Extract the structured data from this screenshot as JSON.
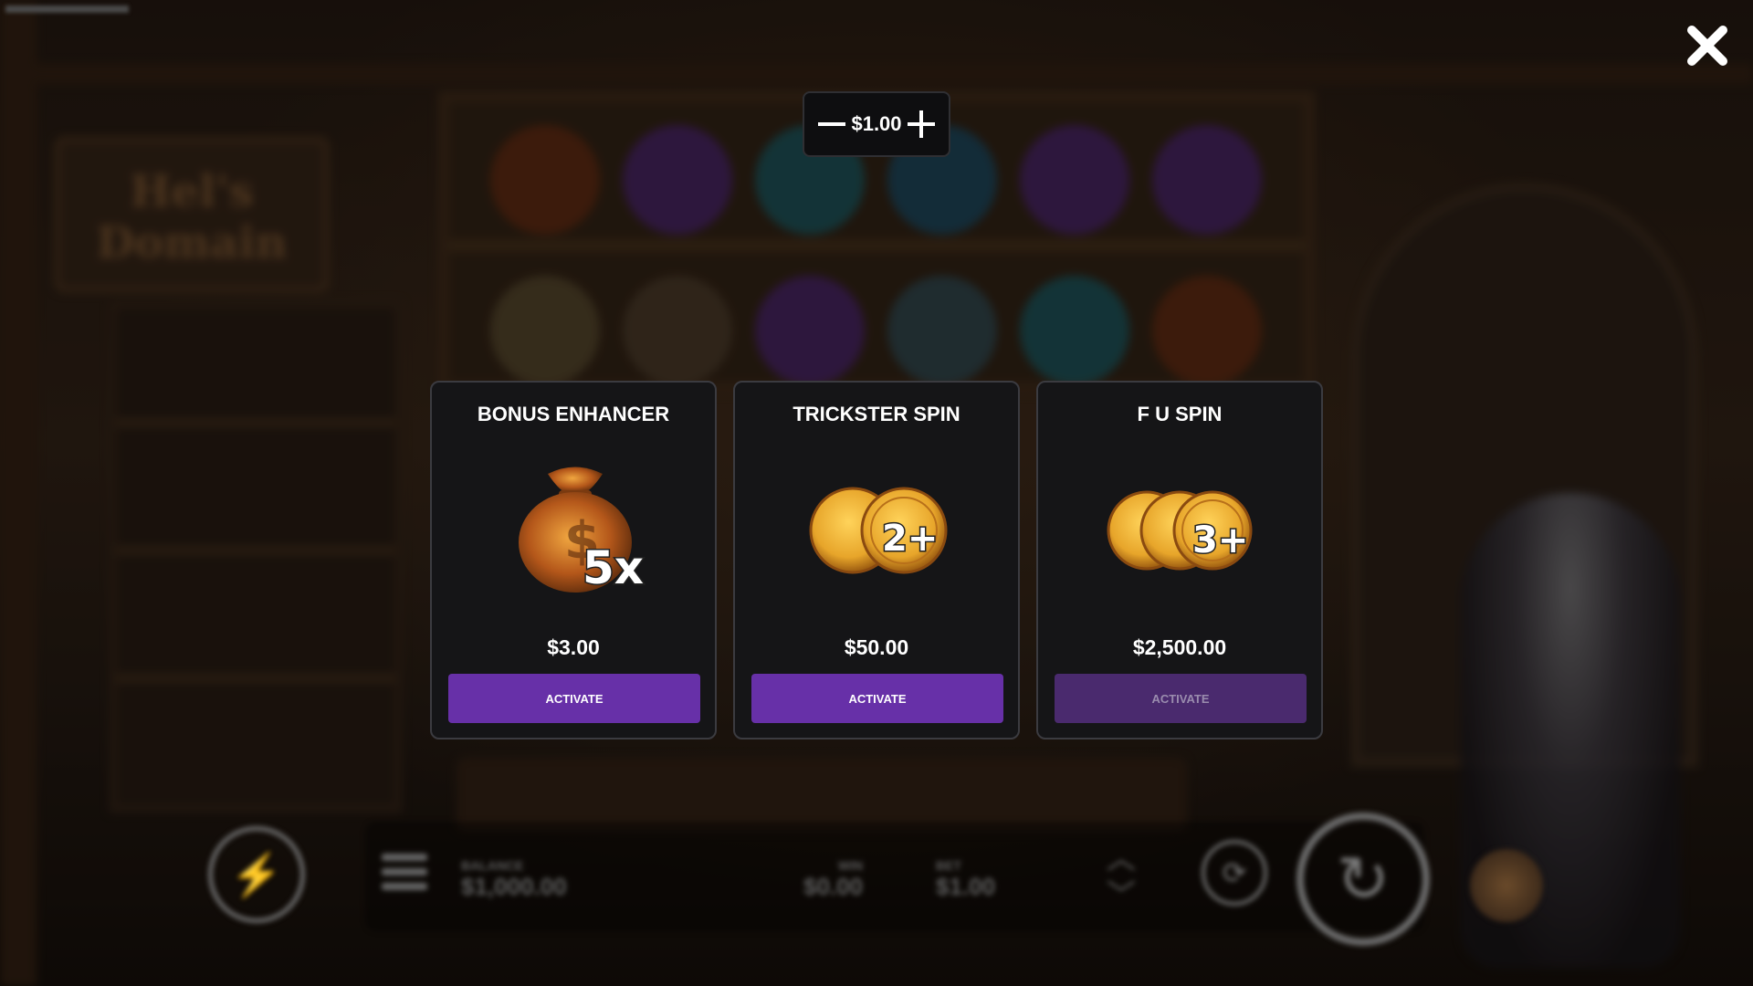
{
  "background": {
    "sign_text": "Hel's Domain",
    "bottom_bar": {
      "balance_label": "BALANCE",
      "balance_value": "$1,000.00",
      "win_label": "WIN",
      "win_value": "$0.00",
      "bet_label": "BET",
      "bet_value": "$1.00"
    }
  },
  "bet_stepper": {
    "value": "$1.00"
  },
  "cards": [
    {
      "title": "BONUS ENHANCER",
      "price": "$3.00",
      "button_label": "ACTIVATE",
      "art_badge": "5x",
      "enabled": true
    },
    {
      "title": "TRICKSTER SPIN",
      "price": "$50.00",
      "button_label": "ACTIVATE",
      "art_badge": "2+",
      "enabled": true
    },
    {
      "title": "F U SPIN",
      "price": "$2,500.00",
      "button_label": "ACTIVATE",
      "art_badge": "3+",
      "enabled": false
    }
  ],
  "colors": {
    "activate_button": "#6730a8",
    "activate_button_disabled": "#4a2a6e",
    "card_background": "#151517",
    "coin_gold": "#e7a52a"
  },
  "icons": {
    "close": "close-icon",
    "minus": "minus-icon",
    "plus": "plus-icon"
  }
}
